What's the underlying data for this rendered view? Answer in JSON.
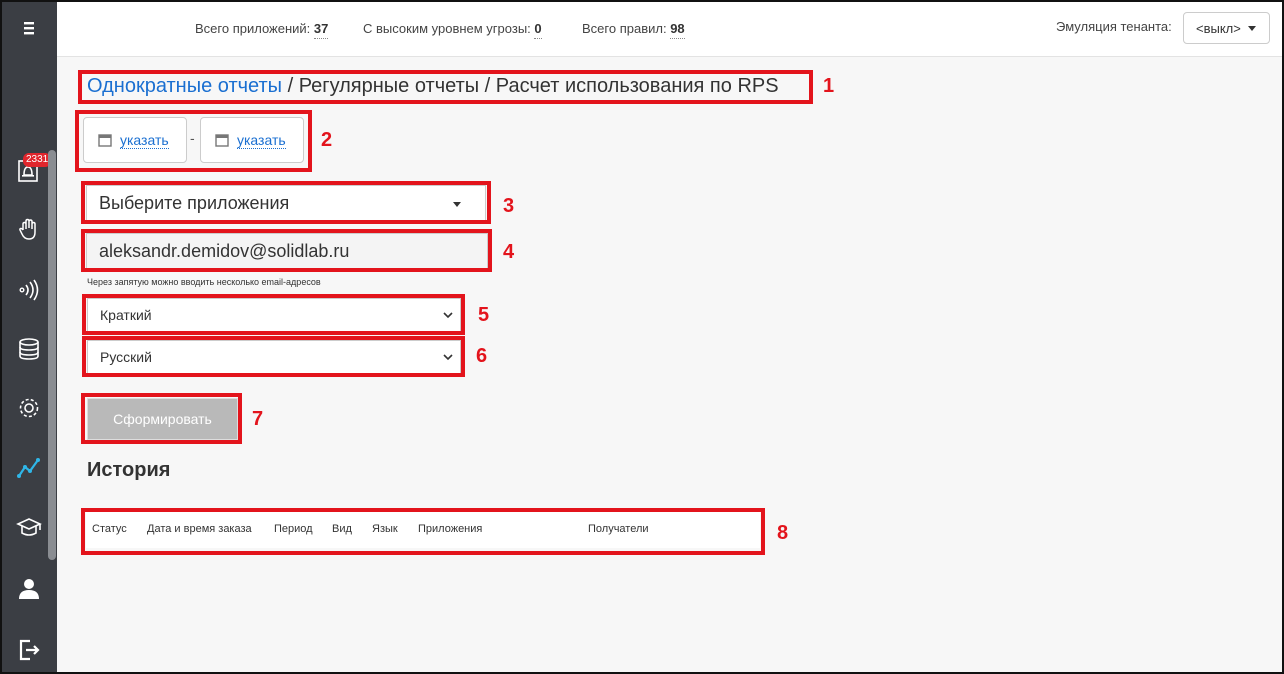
{
  "header": {
    "stats": [
      {
        "label": "Всего приложений:",
        "value": "37"
      },
      {
        "label": "С высоким уровнем угрозы:",
        "value": "0"
      },
      {
        "label": "Всего правил:",
        "value": "98"
      }
    ],
    "tenant_label": "Эмуляция тенанта:",
    "tenant_value": "<выкл>"
  },
  "sidebar": {
    "alerts_badge": "2331",
    "items": [
      "menu-icon",
      "alerts-icon",
      "hand-icon",
      "signal-icon",
      "database-icon",
      "gear-icon",
      "analytics-icon",
      "graduation-cap-icon",
      "user-icon",
      "logout-icon"
    ]
  },
  "breadcrumb": {
    "link": "Однократные отчеты",
    "rest": " / Регулярные отчеты / Расчет использования по RPS"
  },
  "dates": {
    "from_label": "указать",
    "to_label": "указать",
    "separator": "-"
  },
  "form": {
    "apps_placeholder": "Выберите приложения",
    "email_value": "aleksandr.demidov@solidlab.ru",
    "email_hint": "Через запятую можно вводить несколько email-адресов",
    "report_type": "Краткий",
    "language": "Русский",
    "submit_label": "Сформировать"
  },
  "history": {
    "title": "История",
    "columns": [
      "Статус",
      "Дата и время заказа",
      "Период",
      "Вид",
      "Язык",
      "Приложения",
      "Получатели"
    ]
  },
  "annotations": [
    "1",
    "2",
    "3",
    "4",
    "5",
    "6",
    "7",
    "8"
  ],
  "colors": {
    "sidebar": "#3b3e44",
    "accent": "#1a6fd1",
    "annotation": "#e3141c",
    "active_icon": "#2fb6e8"
  }
}
